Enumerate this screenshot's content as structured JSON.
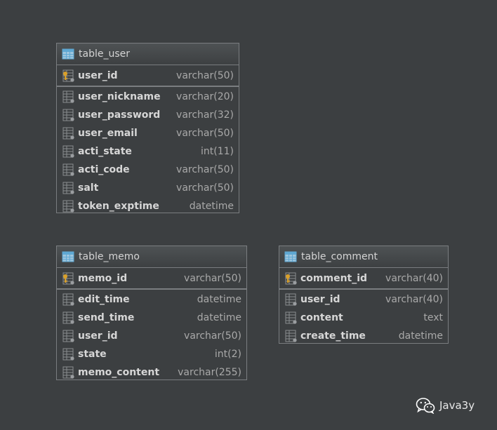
{
  "tables": {
    "user": {
      "name": "table_user",
      "pk": {
        "name": "user_id",
        "type": "varchar(50)"
      },
      "columns": [
        {
          "name": "user_nickname",
          "type": "varchar(20)"
        },
        {
          "name": "user_password",
          "type": "varchar(32)"
        },
        {
          "name": "user_email",
          "type": "varchar(50)"
        },
        {
          "name": "acti_state",
          "type": "int(11)"
        },
        {
          "name": "acti_code",
          "type": "varchar(50)"
        },
        {
          "name": "salt",
          "type": "varchar(50)"
        },
        {
          "name": "token_exptime",
          "type": "datetime"
        }
      ]
    },
    "memo": {
      "name": "table_memo",
      "pk": {
        "name": "memo_id",
        "type": "varchar(50)"
      },
      "columns": [
        {
          "name": "edit_time",
          "type": "datetime"
        },
        {
          "name": "send_time",
          "type": "datetime"
        },
        {
          "name": "user_id",
          "type": "varchar(50)"
        },
        {
          "name": "state",
          "type": "int(2)"
        },
        {
          "name": "memo_content",
          "type": "varchar(255)"
        }
      ]
    },
    "comment": {
      "name": "table_comment",
      "pk": {
        "name": "comment_id",
        "type": "varchar(40)"
      },
      "columns": [
        {
          "name": "user_id",
          "type": "varchar(40)"
        },
        {
          "name": "content",
          "type": "text"
        },
        {
          "name": "create_time",
          "type": "datetime"
        }
      ]
    }
  },
  "watermark": {
    "text": "Java3y",
    "icon": "wechat-icon"
  },
  "icons": {
    "table": "table-icon",
    "primary_key_column": "key-column-icon",
    "column": "column-icon"
  },
  "colors": {
    "background": "#3c3f41",
    "border": "#7a7d80",
    "column_name": "#d6d6d6",
    "column_type": "#a9a9a9",
    "table_icon": "#5fa8d3",
    "key_icon": "#d9a02a"
  }
}
